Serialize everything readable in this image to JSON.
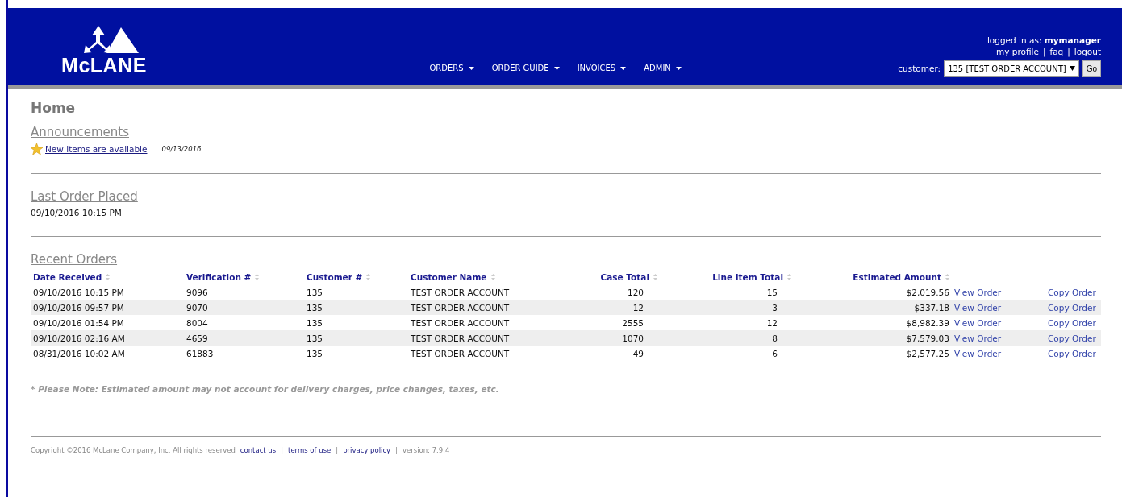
{
  "header": {
    "logo_text": "McLANE",
    "nav": [
      {
        "label": "ORDERS"
      },
      {
        "label": "ORDER GUIDE"
      },
      {
        "label": "INVOICES"
      },
      {
        "label": "ADMIN"
      }
    ],
    "logged_in_label": "logged in as:",
    "username": "mymanager",
    "user_links": [
      {
        "kind": "link",
        "text": "my profile"
      },
      {
        "kind": "separator",
        "text": "|"
      },
      {
        "kind": "link",
        "text": "faq"
      },
      {
        "kind": "separator",
        "text": "|"
      },
      {
        "kind": "link",
        "text": "logout"
      }
    ],
    "customer_label": "customer:",
    "customer_value": "135 [TEST ORDER ACCOUNT]",
    "go_button": "Go"
  },
  "page_title": "Home",
  "announcements": {
    "title": "Announcements",
    "items": [
      {
        "text": "New items are available",
        "date": "09/13/2016"
      }
    ]
  },
  "last_order": {
    "title": "Last Order Placed",
    "value": "09/10/2016 10:15 PM"
  },
  "recent_orders": {
    "title": "Recent Orders",
    "columns": [
      {
        "label": "Date Received"
      },
      {
        "label": "Verification #"
      },
      {
        "label": "Customer #"
      },
      {
        "label": "Customer Name"
      },
      {
        "label": "Case Total"
      },
      {
        "label": "Line Item Total"
      },
      {
        "label": "Estimated Amount"
      }
    ],
    "rows": [
      {
        "cells": [
          "09/10/2016 10:15 PM",
          "9096",
          "135",
          "TEST ORDER ACCOUNT",
          "120",
          "15",
          "$2,019.56"
        ],
        "view": "View Order",
        "copy": "Copy Order"
      },
      {
        "cells": [
          "09/10/2016 09:57 PM",
          "9070",
          "135",
          "TEST ORDER ACCOUNT",
          "12",
          "3",
          "$337.18"
        ],
        "view": "View Order",
        "copy": "Copy Order"
      },
      {
        "cells": [
          "09/10/2016 01:54 PM",
          "8004",
          "135",
          "TEST ORDER ACCOUNT",
          "2555",
          "12",
          "$8,982.39"
        ],
        "view": "View Order",
        "copy": "Copy Order"
      },
      {
        "cells": [
          "09/10/2016 02:16 AM",
          "4659",
          "135",
          "TEST ORDER ACCOUNT",
          "1070",
          "8",
          "$7,579.03"
        ],
        "view": "View Order",
        "copy": "Copy Order"
      },
      {
        "cells": [
          "08/31/2016 10:02 AM",
          "61883",
          "135",
          "TEST ORDER ACCOUNT",
          "49",
          "6",
          "$2,577.25"
        ],
        "view": "View Order",
        "copy": "Copy Order"
      }
    ]
  },
  "note": "* Please Note: Estimated amount may not account for delivery charges, price changes, taxes, etc.",
  "footer": {
    "items": [
      {
        "kind": "text",
        "text": "Copyright ©2016 McLane Company, Inc. All rights reserved"
      },
      {
        "kind": "link",
        "text": "contact us"
      },
      {
        "kind": "separator",
        "text": "|"
      },
      {
        "kind": "link",
        "text": "terms of use"
      },
      {
        "kind": "separator",
        "text": "|"
      },
      {
        "kind": "link",
        "text": "privacy policy"
      },
      {
        "kind": "separator",
        "text": "|"
      },
      {
        "kind": "text",
        "text": "version: 7.9.4"
      }
    ]
  }
}
